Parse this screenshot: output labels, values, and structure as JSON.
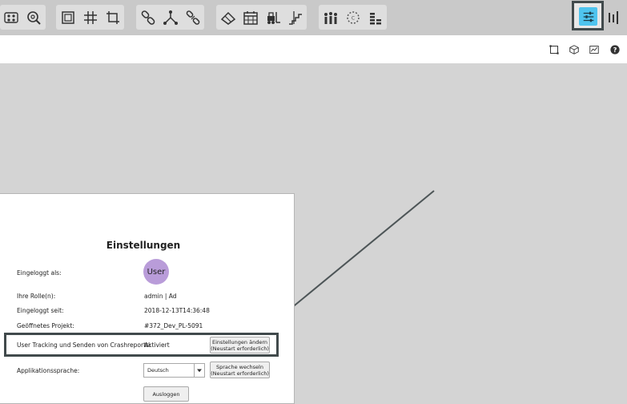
{
  "toolbar": {
    "groups": [
      {
        "icons": [
          "network-nodes-icon",
          "zoom-search-icon"
        ]
      },
      {
        "icons": [
          "frame-icon",
          "grid-icon",
          "crop-icon"
        ]
      },
      {
        "icons": [
          "chain-link-icon",
          "tree-icon",
          "chain-break-icon"
        ]
      },
      {
        "icons": [
          "eraser-icon",
          "calendar-table-icon",
          "forklift-icon",
          "stairs-icon"
        ]
      },
      {
        "icons": [
          "team-icon",
          "dotted-circle-icon",
          "coin-stack-icon"
        ]
      }
    ],
    "settings_icon": "sliders-icon",
    "side_icon": "vertical-bars-icon"
  },
  "subbar": {
    "icons": [
      "rectangle-select-icon",
      "cube-icon",
      "chart-icon",
      "help-icon"
    ]
  },
  "settings": {
    "title": "Einstellungen",
    "logged_in_label": "Eingeloggt als:",
    "avatar_text": "User",
    "roles_label": "Ihre Rolle(n):",
    "roles_value": "admin | Ad",
    "since_label": "Eingeloggt seit:",
    "since_value": "2018-12-13T14:36:48",
    "project_label": "Geöffnetes Projekt:",
    "project_value": "#372_Dev_PL-5091",
    "tracking_label": "User Tracking und Senden von Crashreports:",
    "tracking_value": "Aktiviert",
    "change_settings_line1": "Einstellungen ändern",
    "change_settings_line2": "(Neustart erforderlich)",
    "language_label": "Applikationssprache:",
    "language_value": "Deutsch",
    "change_language_line1": "Sprache wechseln",
    "change_language_line2": "(Neustart erforderlich)",
    "logout_label": "Ausloggen"
  },
  "colors": {
    "accent": "#4fc4ee",
    "highlight_border": "#414a4c",
    "avatar": "#b99cd9"
  }
}
